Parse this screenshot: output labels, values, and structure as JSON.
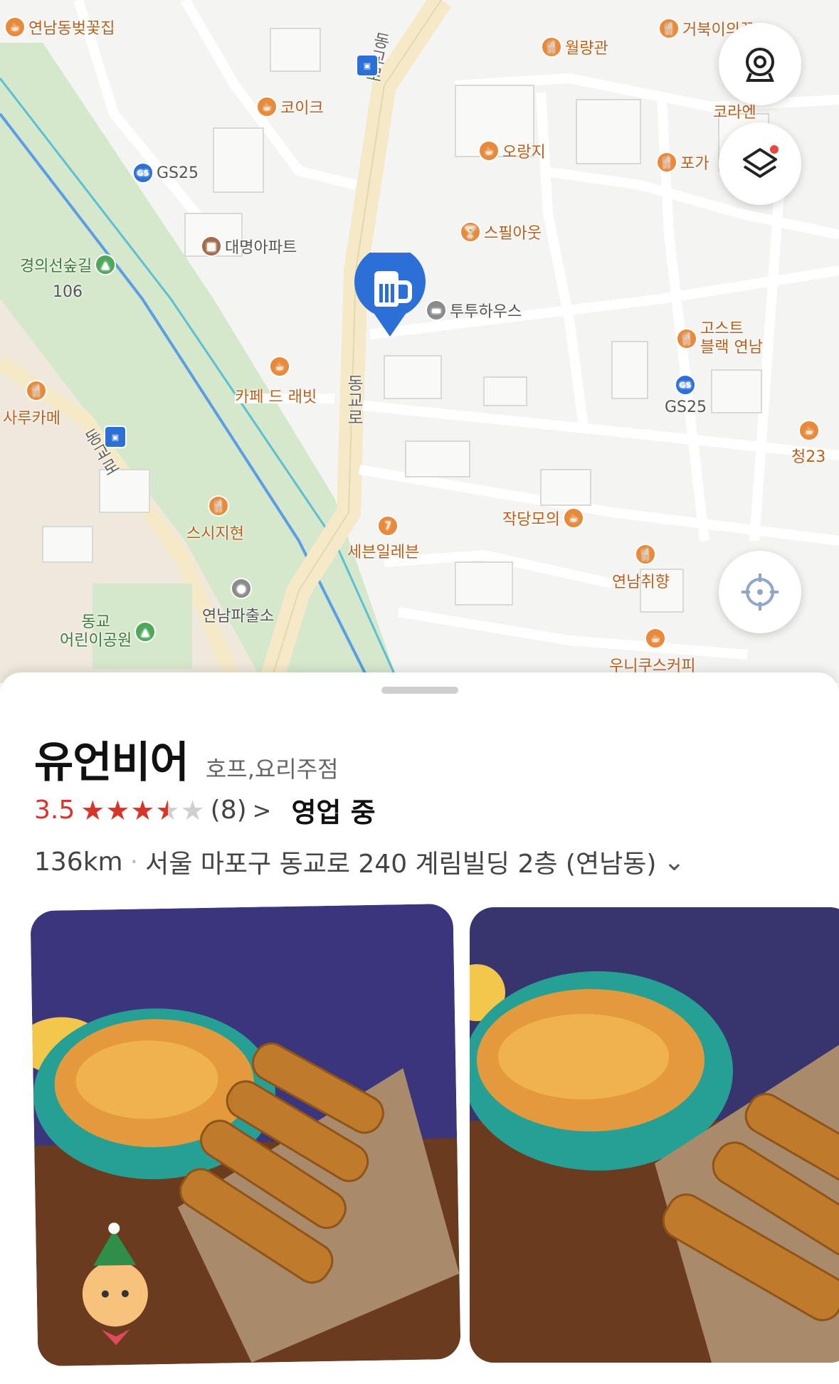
{
  "map": {
    "pois": [
      {
        "label": "연남동벚꽃집",
        "type": "cafe"
      },
      {
        "label": "월량관",
        "type": "restaurant"
      },
      {
        "label": "거북이의꿈",
        "type": "restaurant"
      },
      {
        "label": "코이크",
        "type": "cafe"
      },
      {
        "label": "코라엔",
        "type": "restaurant"
      },
      {
        "label": "오랑지",
        "type": "cafe"
      },
      {
        "label": "포가",
        "type": "restaurant"
      },
      {
        "label": "GS25",
        "type": "convenience"
      },
      {
        "label": "스필아웃",
        "type": "bar"
      },
      {
        "label": "대명아파트",
        "type": "apartment"
      },
      {
        "label": "경의선숲길",
        "type": "park"
      },
      {
        "label": "106",
        "type": "text"
      },
      {
        "label": "투투하우스",
        "type": "lodging"
      },
      {
        "label": "고스트",
        "type": "restaurant"
      },
      {
        "label": "블랙 연남",
        "type": "text"
      },
      {
        "label": "카페 드 래빗",
        "type": "cafe"
      },
      {
        "label": "사루카메",
        "type": "restaurant"
      },
      {
        "label": "GS25",
        "type": "convenience"
      },
      {
        "label": "청23",
        "type": "cafe"
      },
      {
        "label": "스시지현",
        "type": "restaurant"
      },
      {
        "label": "작당모의",
        "type": "cafe"
      },
      {
        "label": "세븐일레븐",
        "type": "convenience"
      },
      {
        "label": "연남취향",
        "type": "restaurant"
      },
      {
        "label": "연남파출소",
        "type": "police"
      },
      {
        "label": "동교",
        "type": "park"
      },
      {
        "label": "어린이공원",
        "type": "text"
      },
      {
        "label": "우니쿠스커피",
        "type": "cafe"
      }
    ],
    "road_labels": [
      "동교로",
      "동교로",
      "동교로"
    ],
    "selected_pin_icon": "beer-mug-icon",
    "controls": {
      "cctv_icon": "cctv-icon",
      "layers_icon": "layers-icon",
      "locate_icon": "crosshair-icon"
    },
    "colors": {
      "water": "#5b9ee6",
      "park": "#d6e8cc",
      "road": "#ffffff",
      "main_road": "#f5e9c8",
      "accent": "#2c6fd6"
    }
  },
  "place": {
    "name": "유언비어",
    "category": "호프,요리주점",
    "rating": "3.5",
    "star_fill": 3.5,
    "review_count": "(8)",
    "review_chevron": ">",
    "status": "영업 중",
    "distance": "136km",
    "separator": "·",
    "address": "서울 마포구 동교로 240 계림빌딩 2층 (연남동)",
    "address_chevron": "⌄"
  },
  "photos": [
    {
      "alt": "tteokbokki-and-fried-shrimp-photo-1"
    },
    {
      "alt": "tteokbokki-and-fried-shrimp-photo-2"
    }
  ]
}
